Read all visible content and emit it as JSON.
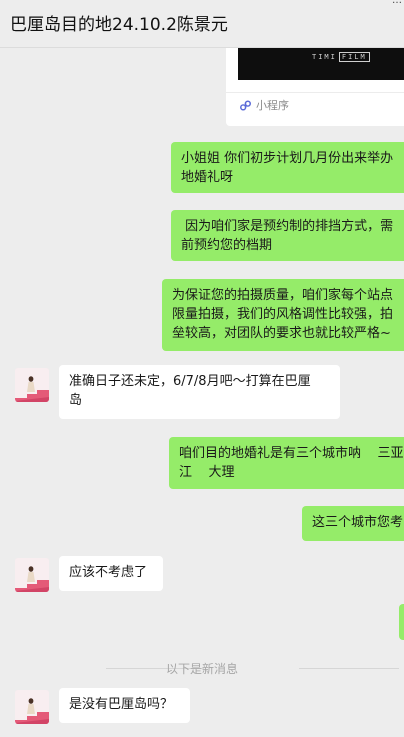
{
  "header": {
    "title": "巴厘岛目的地24.10.2陈景元",
    "more": "…"
  },
  "mini_program": {
    "film_text": "TIMI",
    "film_badge": "FILM",
    "label": "小程序"
  },
  "messages": [
    {
      "side": "right",
      "text": "小姐姐 你们初步计划几月份出来举办\n地婚礼呀"
    },
    {
      "side": "right",
      "text": " 因为咱们家是预约制的排挡方式，需\n前预约您的档期"
    },
    {
      "side": "right",
      "text": "为保证您的拍摄质量，咱们家每个站点\n限量拍摄，我们的风格调性比较强，拍\n垒较高，对团队的要求也就比较严格~"
    },
    {
      "side": "left",
      "text": "准确日子还未定，6/7/8月吧～打算在巴厘\n岛"
    },
    {
      "side": "right",
      "text": "咱们目的地婚礼是有三个城市呐    三亚\n江    大理"
    },
    {
      "side": "right",
      "text": "这三个城市您考"
    },
    {
      "side": "left",
      "text": "应该不考虑了"
    },
    {
      "side": "right",
      "text": ""
    },
    {
      "side": "left",
      "text": "是没有巴厘岛吗？"
    }
  ],
  "separator": {
    "text": "以下是新消息"
  },
  "colors": {
    "right_bubble": "#95ec69",
    "left_bubble": "#ffffff",
    "background": "#ededed"
  }
}
